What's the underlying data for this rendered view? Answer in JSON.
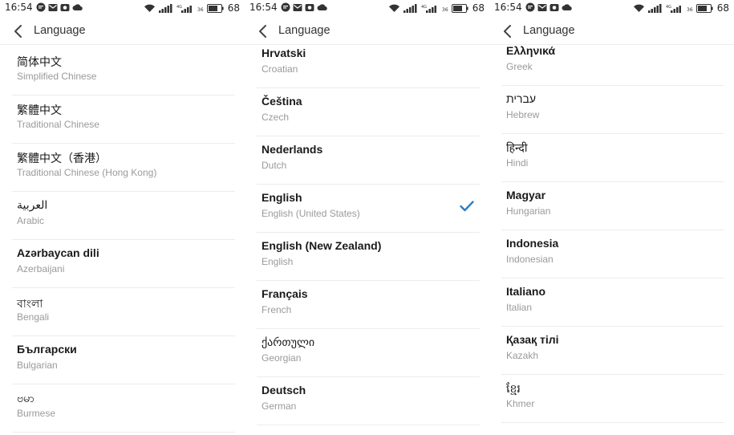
{
  "status_bar": {
    "time": "16:54",
    "battery": "68"
  },
  "header": {
    "title": "Language"
  },
  "accent_color": "#2b7fc4",
  "screens": [
    {
      "items": [
        {
          "native": "简体中文",
          "english": "Simplified Chinese"
        },
        {
          "native": "繁體中文",
          "english": "Traditional Chinese"
        },
        {
          "native": "繁體中文（香港）",
          "english": "Traditional Chinese (Hong Kong)"
        },
        {
          "native": "العربية",
          "english": "Arabic"
        },
        {
          "native": "Azərbaycan dili",
          "english": "Azerbaijani"
        },
        {
          "native": "বাংলা",
          "english": "Bengali"
        },
        {
          "native": "Български",
          "english": "Bulgarian"
        },
        {
          "native": "ဗမာ",
          "english": "Burmese"
        }
      ]
    },
    {
      "items": [
        {
          "native": "Hrvatski",
          "english": "Croatian"
        },
        {
          "native": "Čeština",
          "english": "Czech"
        },
        {
          "native": "Nederlands",
          "english": "Dutch"
        },
        {
          "native": "English",
          "english": "English (United States)",
          "selected": true
        },
        {
          "native": "English (New Zealand)",
          "english": "English"
        },
        {
          "native": "Français",
          "english": "French"
        },
        {
          "native": "ქართული",
          "english": "Georgian"
        },
        {
          "native": "Deutsch",
          "english": "German"
        }
      ]
    },
    {
      "items": [
        {
          "native": "Ελληνικά",
          "english": "Greek"
        },
        {
          "native": "עברית",
          "english": "Hebrew"
        },
        {
          "native": "हिन्दी",
          "english": "Hindi"
        },
        {
          "native": "Magyar",
          "english": "Hungarian"
        },
        {
          "native": "Indonesia",
          "english": "Indonesian"
        },
        {
          "native": "Italiano",
          "english": "Italian"
        },
        {
          "native": "Қазақ тілі",
          "english": "Kazakh"
        },
        {
          "native": "ខ្មែរ",
          "english": "Khmer"
        }
      ]
    }
  ]
}
